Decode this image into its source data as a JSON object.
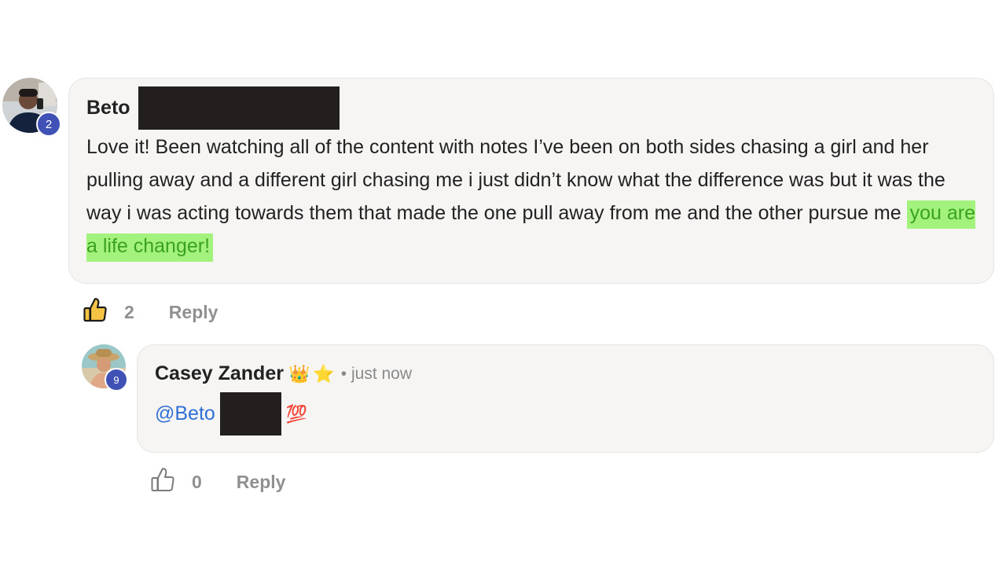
{
  "comment": {
    "author": "Beto",
    "level": "2",
    "body": "Love it! Been watching all of the content with notes I’ve been on both sides chasing a girl and her pulling away and a different girl chasing me i just didn’t know what the difference was but it was the way i was acting towards them that made the one pull away from me and the other pursue me",
    "highlight": "you are a life changer!",
    "likes": "2",
    "reply_label": "Reply"
  },
  "reply": {
    "author": "Casey Zander",
    "level": "9",
    "emoji_crown": "👑",
    "emoji_star": "⭐",
    "timestamp": "• just now",
    "mention": "@Beto",
    "emoji_100": "💯",
    "likes": "0",
    "reply_label": "Reply"
  },
  "colors": {
    "highlight_bg": "#a3f27e",
    "highlight_text": "#3aa21e",
    "mention": "#2f6fd6",
    "level_badge": "#3f51b5"
  }
}
